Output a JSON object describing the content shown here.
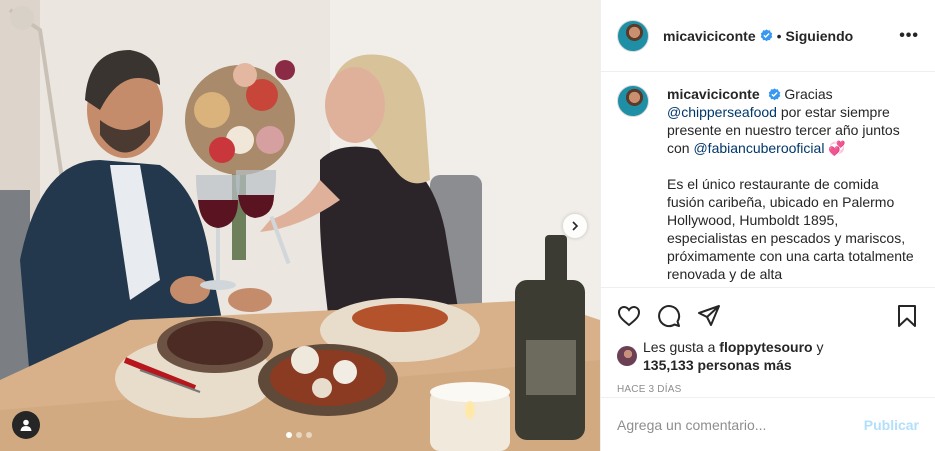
{
  "post": {
    "author": {
      "username": "micaviciconte",
      "verified": true,
      "follow_separator": "•",
      "follow_status": "Siguiendo"
    },
    "more_icon": "more-options-icon",
    "caption": {
      "username": "micaviciconte",
      "text_1": "Gracias",
      "mention_1": "@chipperseafood",
      "text_2": "por estar siempre presente en nuestro tercer año juntos con",
      "mention_2": "@fabiancuberooficial",
      "emoji": "💞",
      "paragraph_2": "Es el único restaurante de comida fusión caribeña, ubicado en Palermo Hollywood, Humboldt 1895, especialistas en pescados y mariscos, próximamente con una carta totalmente renovada y de alta"
    },
    "actions": {
      "like_icon": "heart-icon",
      "comment_icon": "comment-icon",
      "share_icon": "share-icon",
      "save_icon": "bookmark-icon"
    },
    "likes": {
      "prefix": "Les gusta a",
      "user": "floppytesouro",
      "connector": "y",
      "others": "135,133 personas más"
    },
    "time_ago": "HACE 3 DÍAS",
    "comment_input": {
      "placeholder": "Agrega un comentario...",
      "value": ""
    },
    "publish_label": "Publicar",
    "carousel": {
      "total_slides": 3,
      "active_slide": 1
    },
    "colors": {
      "link": "#00376b",
      "publish_disabled": "#b2dffc",
      "verified": "#3897f0",
      "muted": "#8e8e8e"
    }
  }
}
